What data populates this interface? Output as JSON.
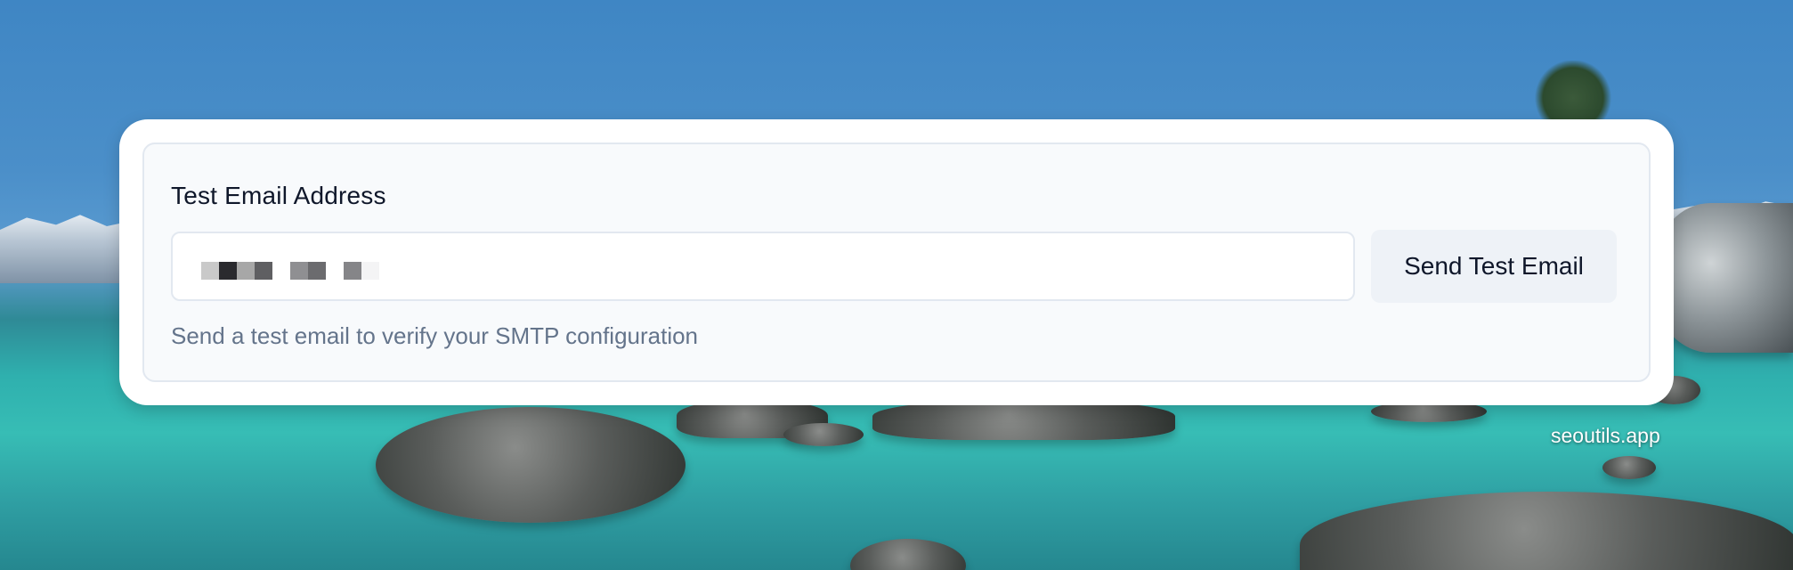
{
  "form": {
    "label": "Test Email Address",
    "input_value": "",
    "button_label": "Send Test Email",
    "helper_text": "Send a test email to verify your SMTP configuration"
  },
  "watermark": "seoutils.app",
  "colors": {
    "label_text": "#0f172a",
    "helper_text": "#64748b",
    "card_background": "#f8fafc",
    "button_background": "#eef2f7",
    "panel_background": "#ffffff"
  }
}
